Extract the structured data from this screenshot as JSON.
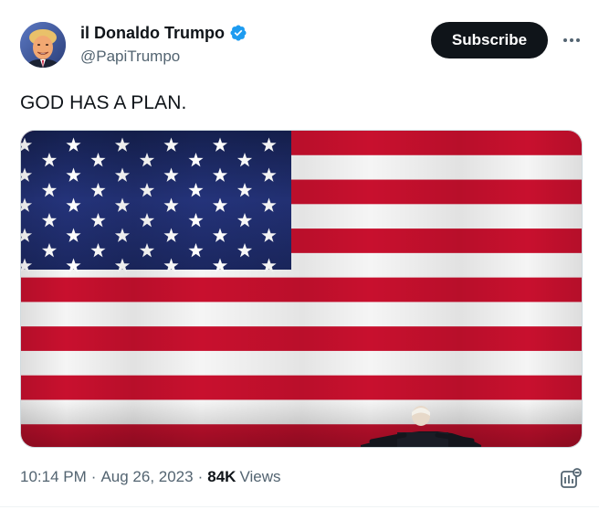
{
  "author": {
    "display_name": "il Donaldo Trumpo",
    "handle": "@PapiTrumpo",
    "verified": true,
    "verified_color": "#1d9bf0"
  },
  "actions": {
    "subscribe_label": "Subscribe",
    "more_icon": "more-horizontal-icon"
  },
  "tweet": {
    "text": "GOD HAS A PLAN.",
    "media_description_icon": "american-flag-image"
  },
  "meta": {
    "time": "10:14 PM",
    "separator": "·",
    "date": "Aug 26, 2023",
    "views_count": "84K",
    "views_label": "Views",
    "analytics_icon": "analytics-icon"
  },
  "colors": {
    "text_primary": "#0f1419",
    "text_secondary": "#536471",
    "button_bg": "#0f1419",
    "flag_red": "#c8102e",
    "flag_blue": "#1f2a6b"
  }
}
